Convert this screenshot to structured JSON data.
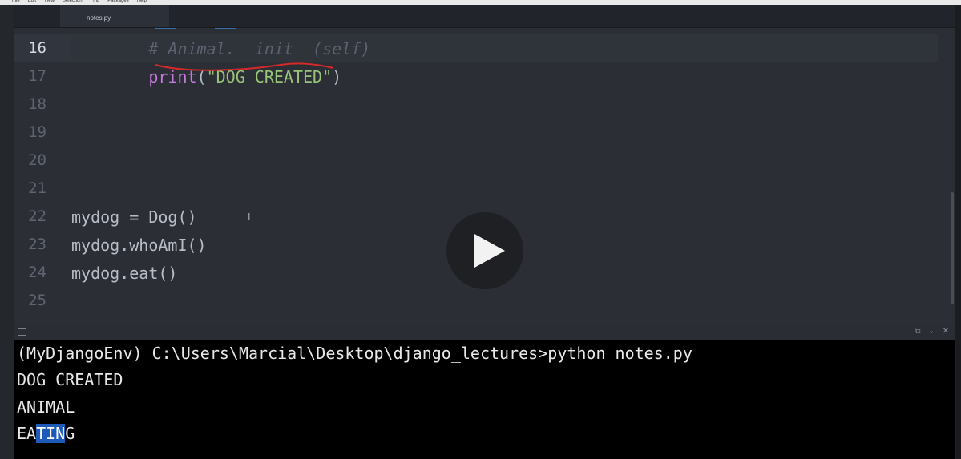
{
  "menu": {
    "items": [
      "File",
      "Edit",
      "View",
      "Selection",
      "Find",
      "Packages",
      "Help"
    ]
  },
  "tabs": [
    {
      "label": "notes.py",
      "active": true
    }
  ],
  "editor": {
    "lines": [
      {
        "number": "16",
        "segments": [
          {
            "text": "        ",
            "style": ""
          },
          {
            "text": "# Animal.__init__(self)",
            "style": "cm"
          }
        ],
        "active": true
      },
      {
        "number": "17",
        "segments": [
          {
            "text": "        ",
            "style": ""
          },
          {
            "text": "print",
            "style": "kw"
          },
          {
            "text": "(",
            "style": ""
          },
          {
            "text": "\"DOG CREATED\"",
            "style": "str"
          },
          {
            "text": ")",
            "style": ""
          }
        ]
      },
      {
        "number": "18",
        "segments": []
      },
      {
        "number": "19",
        "segments": []
      },
      {
        "number": "20",
        "segments": []
      },
      {
        "number": "21",
        "segments": []
      },
      {
        "number": "22",
        "segments": [
          {
            "text": "mydog = Dog()",
            "style": ""
          }
        ]
      },
      {
        "number": "23",
        "segments": [
          {
            "text": "mydog.whoAmI()",
            "style": ""
          }
        ]
      },
      {
        "number": "24",
        "segments": [
          {
            "text": "mydog.eat()",
            "style": ""
          }
        ]
      },
      {
        "number": "25",
        "segments": []
      }
    ]
  },
  "panel": {
    "buttons": [
      "⧉",
      "⌄",
      "✕"
    ]
  },
  "terminal": {
    "prompt_line": "(MyDjangoEnv) C:\\Users\\Marcial\\Desktop\\django_lectures>python notes.py",
    "output": [
      "DOG CREATED",
      "ANIMAL"
    ],
    "last_line": {
      "before": "EA",
      "selected": "TIN",
      "after": "G"
    }
  },
  "video": {
    "play_icon": "play-icon"
  },
  "colors": {
    "editor_bg": "#2b2e35",
    "keyword": "#c678dd",
    "string": "#98c379",
    "comment": "#5c6370",
    "selection": "#1e5bb8",
    "terminal_bg": "#000000"
  }
}
